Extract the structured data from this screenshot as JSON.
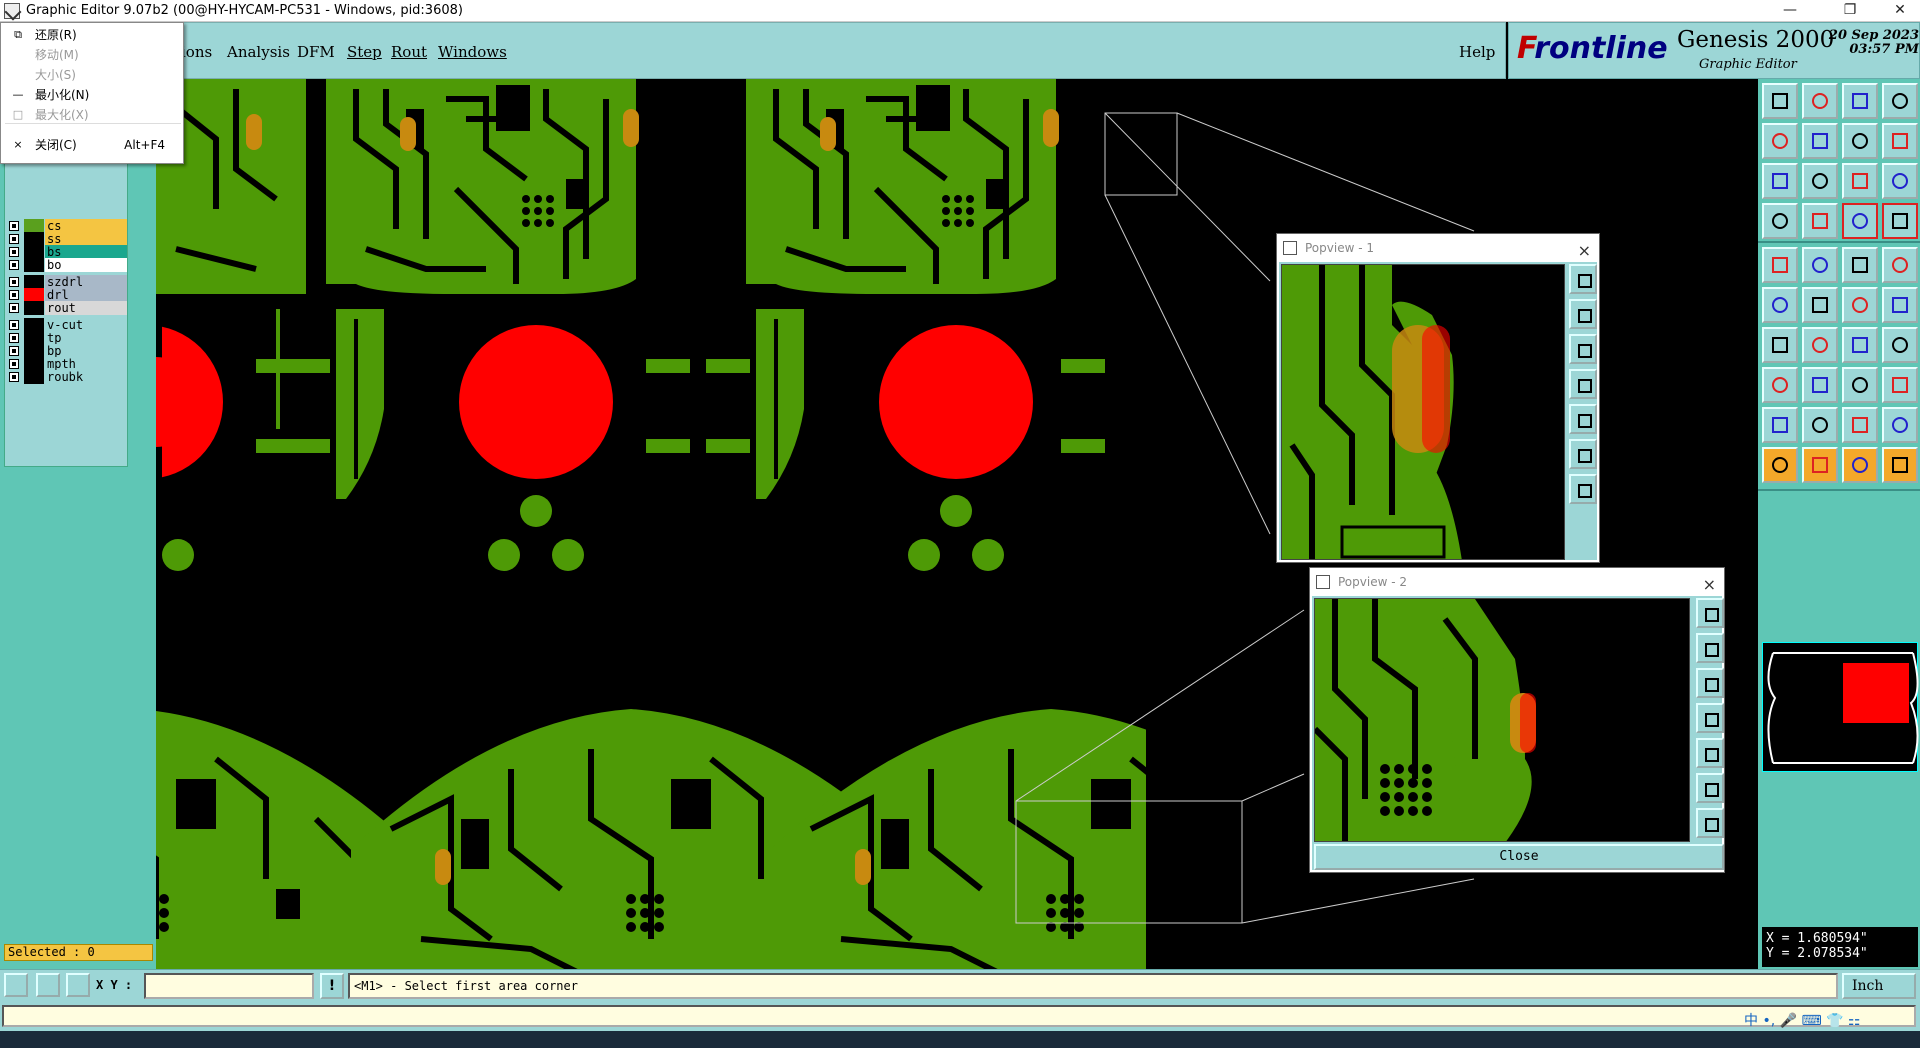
{
  "window": {
    "title": "Graphic Editor 9.07b2 (00@HY-HYCAM-PC531 - Windows, pid:3608)",
    "min_glyph": "—",
    "max_glyph": "❐",
    "close_glyph": "✕"
  },
  "system_menu": {
    "items": [
      {
        "label": "还原(R)",
        "glyph": "⧉",
        "enabled": true
      },
      {
        "label": "移动(M)",
        "glyph": "",
        "enabled": false
      },
      {
        "label": "大小(S)",
        "glyph": "",
        "enabled": false
      },
      {
        "label": "最小化(N)",
        "glyph": "—",
        "enabled": true
      },
      {
        "label": "最大化(X)",
        "glyph": "□",
        "enabled": false
      },
      {
        "label": "关闭(C)",
        "glyph": "×",
        "enabled": true,
        "accel": "Alt+F4"
      }
    ]
  },
  "menubar": {
    "items": [
      {
        "label": "Actions",
        "visible_text": "ions"
      },
      {
        "label": "Analysis"
      },
      {
        "label": "DFM"
      },
      {
        "label": "Step"
      },
      {
        "label": "Rout"
      },
      {
        "label": "Windows"
      }
    ],
    "help": "Help"
  },
  "logo": {
    "frontline_first": "F",
    "frontline_rest": "rontline",
    "product": "Genesis 2000",
    "subtitle": "Graphic Editor",
    "date": "20 Sep 2023",
    "time": "03:57 PM"
  },
  "layers": [
    {
      "name": "cs",
      "color": "#5aa01e",
      "label_bg": "#f4c542"
    },
    {
      "name": "ss",
      "color": "#000000",
      "label_bg": "#f4c542"
    },
    {
      "name": "bs",
      "color": "#000000",
      "label_bg": "#1aa78e"
    },
    {
      "name": "bo",
      "color": "#000000",
      "label_bg": "#ffffff"
    },
    {
      "name": "szdrl",
      "color": "#000000",
      "label_bg": "#a8b8c8"
    },
    {
      "name": "drl",
      "color": "#ff0000",
      "label_bg": "#a8b8c8"
    },
    {
      "name": "rout",
      "color": "#000000",
      "label_bg": "#d8d8d8"
    },
    {
      "name": "v-cut",
      "color": "#000000",
      "label_bg": "#9cd6d6"
    },
    {
      "name": "tp",
      "color": "#000000",
      "label_bg": "#9cd6d6"
    },
    {
      "name": "bp",
      "color": "#000000",
      "label_bg": "#9cd6d6"
    },
    {
      "name": "mpth",
      "color": "#000000",
      "label_bg": "#9cd6d6"
    },
    {
      "name": "roubk",
      "color": "#000000",
      "label_bg": "#9cd6d6"
    }
  ],
  "selected": "Selected : 0",
  "popview1": {
    "title": "Popview - 1"
  },
  "popview2": {
    "title": "Popview - 2",
    "close_label": "Close"
  },
  "coords": {
    "x": "X = 1.680594\"",
    "y": "Y = 2.078534\""
  },
  "statusbar": {
    "xy_label": "X Y :",
    "xy_value": "",
    "exclaim": "!",
    "prompt": "<M1> - Select first area corner",
    "units": "Inch"
  },
  "ime": "中 •, 🎤 ⌨ 👕 ⚏",
  "colors": {
    "panel": "#9cd6d6",
    "side": "#5fc6b5",
    "copper": "#4e9a06",
    "drill": "#ff0000",
    "pad": "#c88a10"
  }
}
